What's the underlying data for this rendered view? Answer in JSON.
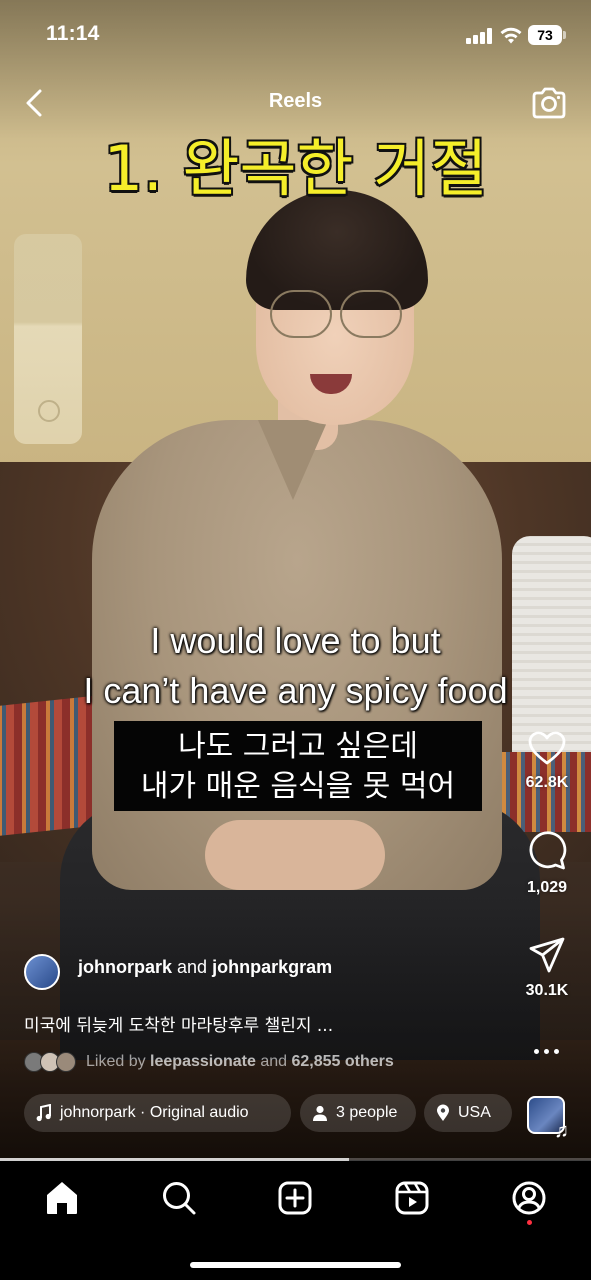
{
  "status_bar": {
    "time": "11:14",
    "battery": "73"
  },
  "header": {
    "title": "Reels",
    "back_icon": "chevron-left-icon",
    "camera_icon": "camera-icon"
  },
  "video": {
    "headline": "1. 완곡한 거절",
    "caption_en_line1": "I would love to but",
    "caption_en_line2": "I can’t have any spicy food",
    "caption_ko_line1": "나도 그러고 싶은데",
    "caption_ko_line2": "내가 매운 음식을 못 먹어",
    "progress": 0.59
  },
  "actions": {
    "likes": "62.8K",
    "comments": "1,029",
    "shares": "30.1K",
    "like_icon": "heart-icon",
    "comment_icon": "comment-bubble-icon",
    "share_icon": "paper-plane-icon",
    "more_icon": "more-horizontal-icon"
  },
  "creator": {
    "username": "johnorpark",
    "connector": "and",
    "collaborator": "johnparkgram",
    "description": "미국에 뒤늦게 도착한 마라탕후루 챌린지 ..."
  },
  "liked_by": {
    "prefix": "Liked by",
    "user": "leepassionate",
    "connector": "and",
    "others": "62,855 others"
  },
  "chips": {
    "audio": "johnorpark · Original audio",
    "people": "3 people",
    "location": "USA"
  },
  "nav": {
    "items": [
      "home-icon",
      "search-icon",
      "create-plus-icon",
      "reels-icon",
      "profile-icon"
    ],
    "active": "home-icon"
  },
  "colors": {
    "headline": "#f5ee2a",
    "accent_dot": "#ff3040"
  }
}
